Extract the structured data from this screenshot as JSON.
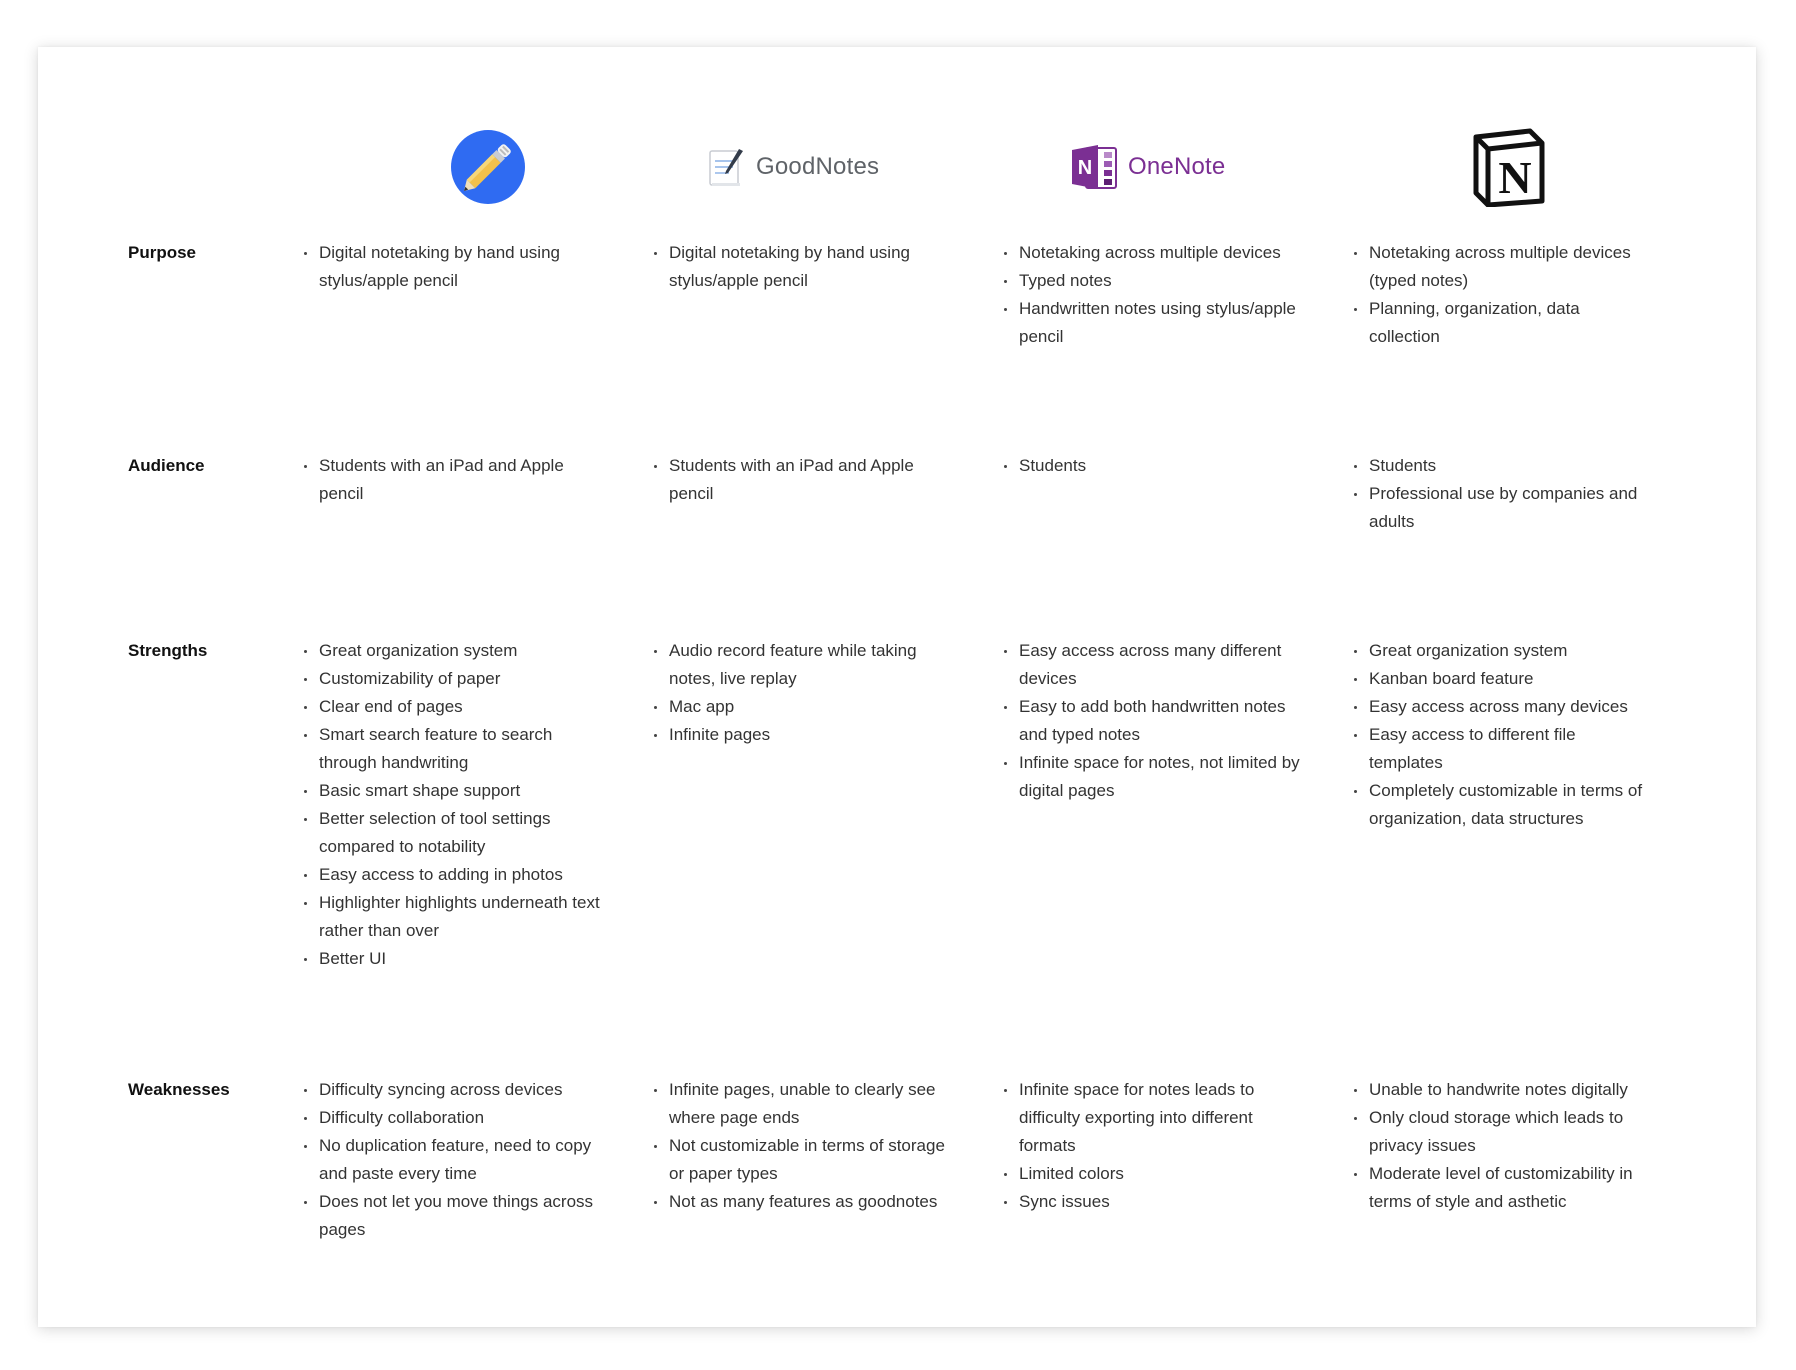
{
  "columns": [
    {
      "name": "Notability",
      "logo": "notability-pencil-icon",
      "brand_text": ""
    },
    {
      "name": "GoodNotes",
      "logo": "goodnotes-notepad-icon",
      "brand_text": "GoodNotes"
    },
    {
      "name": "OneNote",
      "logo": "onenote-icon",
      "brand_text": "OneNote"
    },
    {
      "name": "Notion",
      "logo": "notion-n-icon",
      "brand_text": ""
    }
  ],
  "colors": {
    "notability_blue": "#2f6bf2",
    "onenote_purple": "#7b2f93",
    "goodnotes_gray": "#5f6368",
    "notion_black": "#111111"
  },
  "rows": [
    {
      "label": "Purpose",
      "cells": [
        [
          "Digital notetaking by hand using stylus/apple pencil"
        ],
        [
          "Digital notetaking by hand using stylus/apple pencil"
        ],
        [
          "Notetaking across multiple devices",
          "Typed notes",
          "Handwritten notes using stylus/apple pencil"
        ],
        [
          "Notetaking across multiple devices (typed notes)",
          "Planning, organization, data collection"
        ]
      ]
    },
    {
      "label": "Audience",
      "cells": [
        [
          "Students with an iPad and Apple pencil"
        ],
        [
          "Students with an iPad and Apple pencil"
        ],
        [
          "Students"
        ],
        [
          "Students",
          "Professional use by companies and adults"
        ]
      ]
    },
    {
      "label": "Strengths",
      "cells": [
        [
          "Great organization system",
          "Customizability of paper",
          "Clear end of pages",
          "Smart search feature to search through handwriting",
          "Basic smart shape support",
          "Better selection of tool settings compared to notability",
          "Easy access to adding in photos",
          "Highlighter highlights underneath text rather than over",
          "Better UI"
        ],
        [
          "Audio record feature while taking notes, live replay",
          "Mac app",
          "Infinite pages"
        ],
        [
          "Easy access across many different devices",
          "Easy to add both handwritten notes and typed notes",
          "Infinite space for notes, not limited by digital pages"
        ],
        [
          "Great organization system",
          "Kanban board feature",
          "Easy access across many devices",
          "Easy access to different file templates",
          "Completely customizable in terms of organization, data structures"
        ]
      ]
    },
    {
      "label": "Weaknesses",
      "cells": [
        [
          "Difficulty syncing across devices",
          "Difficulty collaboration",
          "No duplication feature, need to copy and paste every time",
          "Does not let you move things across pages"
        ],
        [
          "Infinite pages, unable to clearly see where page ends",
          "Not customizable in terms of storage or paper types",
          "Not as many features as goodnotes"
        ],
        [
          "Infinite space for notes leads to difficulty exporting into different formats",
          "Limited colors",
          "Sync issues"
        ],
        [
          "Unable to handwrite notes digitally",
          "Only cloud storage which leads to privacy issues",
          "Moderate level of customizability in terms of style and asthetic"
        ]
      ]
    }
  ]
}
